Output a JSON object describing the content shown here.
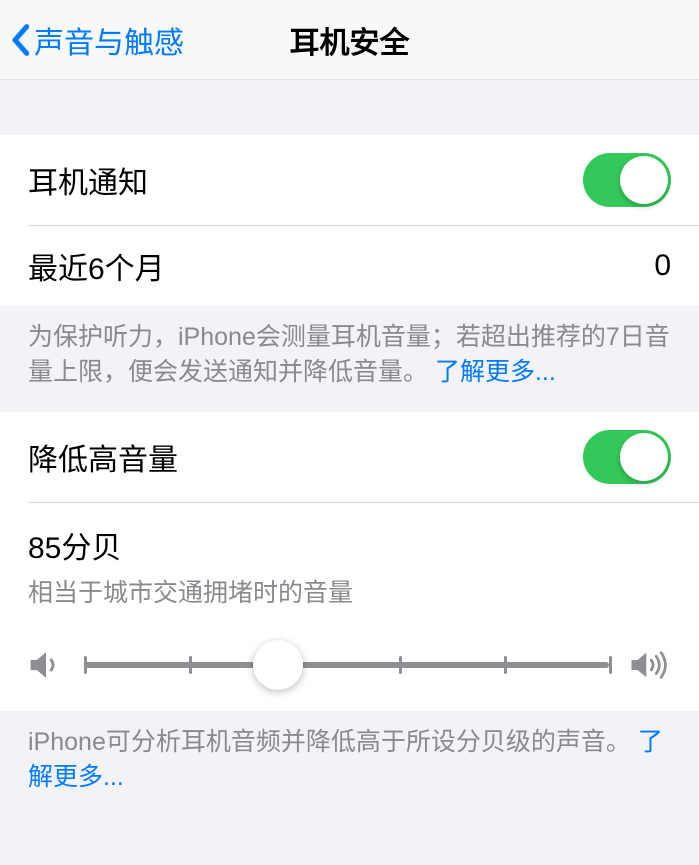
{
  "nav": {
    "back_label": "声音与触感",
    "title": "耳机安全"
  },
  "section1": {
    "notification_label": "耳机通知",
    "notification_on": true,
    "recent_label": "最近6个月",
    "recent_value": "0",
    "footer_text": "为保护听力，iPhone会测量耳机音量；若超出推荐的7日音量上限，便会发送通知并降低音量。",
    "footer_link": "了解更多..."
  },
  "section2": {
    "reduce_label": "降低高音量",
    "reduce_on": true,
    "decibel_value": "85分贝",
    "decibel_sub": "相当于城市交通拥堵时的音量",
    "slider_percent": 37,
    "footer_text": "iPhone可分析耳机音频并降低高于所设分贝级的声音。",
    "footer_link": "了解更多..."
  }
}
